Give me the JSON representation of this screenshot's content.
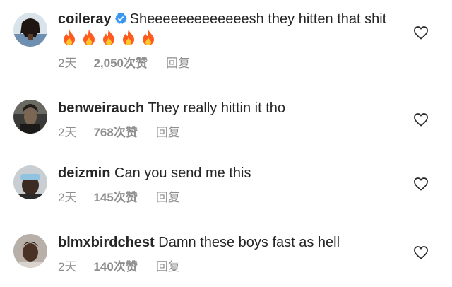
{
  "comments": [
    {
      "username": "coileray",
      "verified": true,
      "text": "Sheeeeeeeeeeeeesh they hitten that shit",
      "emoji": [
        "fire",
        "fire",
        "fire",
        "fire",
        "fire"
      ],
      "time": "2天",
      "likes": "2,050次赞",
      "reply": "回复"
    },
    {
      "username": "benweirauch",
      "verified": false,
      "text": "They really hittin it tho",
      "time": "2天",
      "likes": "768次赞",
      "reply": "回复"
    },
    {
      "username": "deizmin",
      "verified": false,
      "text": "Can you send me this",
      "time": "2天",
      "likes": "145次赞",
      "reply": "回复"
    },
    {
      "username": "blmxbirdchest",
      "verified": false,
      "text": "Damn these boys fast as hell",
      "time": "2天",
      "likes": "140次赞",
      "reply": "回复"
    }
  ],
  "colors": {
    "text": "#262626",
    "meta": "#8e8e8e",
    "verified": "#3897f0",
    "fire": "#ff5a1f"
  }
}
